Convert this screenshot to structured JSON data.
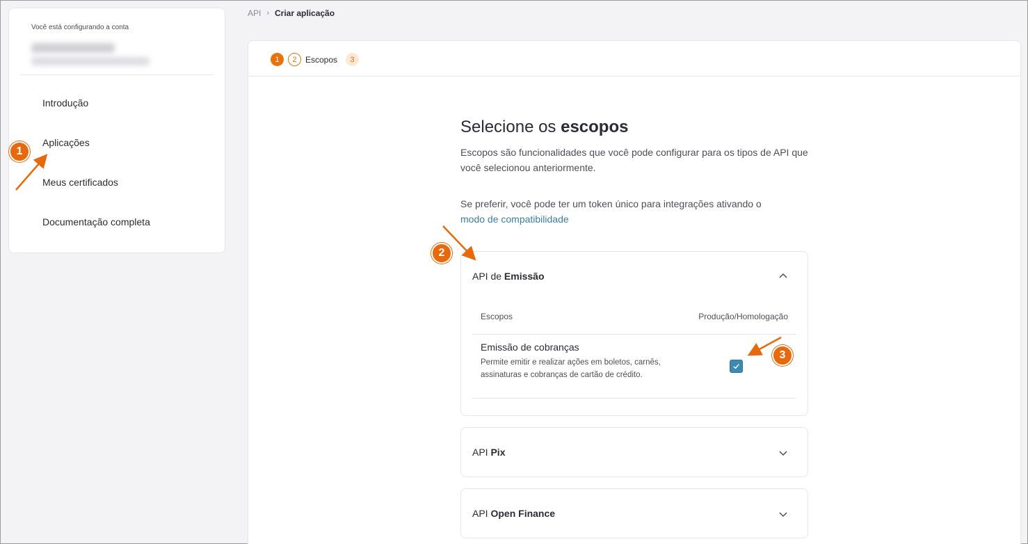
{
  "sidebar": {
    "account_label": "Você está configurando a conta",
    "items": [
      {
        "label": "Introdução"
      },
      {
        "label": "Aplicações"
      },
      {
        "label": "Meus certificados"
      },
      {
        "label": "Documentação completa"
      }
    ]
  },
  "breadcrumb": {
    "root": "API",
    "current": "Criar aplicação"
  },
  "stepper": {
    "step1": "1",
    "step2": "2",
    "step2_label": "Escopos",
    "step3": "3"
  },
  "main": {
    "title_prefix": "Selecione os ",
    "title_bold": "escopos",
    "description": "Escopos são funcionalidades que você pode configurar para os tipos de API que você selecionou anteriormente.",
    "compat_text": "Se preferir, você pode ter um token único para integrações ativando o",
    "compat_link": "modo de compatibilidade"
  },
  "accordions": [
    {
      "prefix": "API de ",
      "name": "Emissão",
      "expanded": true,
      "col_scopes": "Escopos",
      "col_env": "Produção/Homologação",
      "scope_title": "Emissão de cobranças",
      "scope_desc": "Permite emitir e realizar ações em boletos, carnês, assinaturas e cobranças de cartão de crédito.",
      "checked": true
    },
    {
      "prefix": "API ",
      "name": "Pix",
      "expanded": false
    },
    {
      "prefix": "API ",
      "name": "Open Finance",
      "expanded": false
    }
  ],
  "annotations": [
    "1",
    "2",
    "3"
  ],
  "colors": {
    "accent": "#e8720c",
    "link": "#3a7fa6",
    "checkbox": "#3d8bb3"
  }
}
